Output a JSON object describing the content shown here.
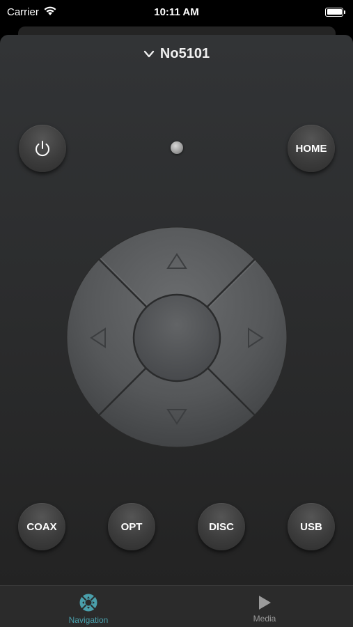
{
  "status_bar": {
    "carrier": "Carrier",
    "time": "10:11 AM",
    "icons": [
      "wifi-icon",
      "battery-icon"
    ]
  },
  "header": {
    "device_name": "No5101",
    "dropdown_icon": "chevron-down-icon"
  },
  "controls": {
    "power_icon": "power-icon",
    "home_label": "HOME",
    "indicator": "led-indicator"
  },
  "dpad": {
    "up_icon": "triangle-up-icon",
    "down_icon": "triangle-down-icon",
    "left_icon": "triangle-left-icon",
    "right_icon": "triangle-right-icon",
    "center": "ok-button"
  },
  "inputs": [
    {
      "label": "COAX"
    },
    {
      "label": "OPT"
    },
    {
      "label": "DISC"
    },
    {
      "label": "USB"
    }
  ],
  "tabs": [
    {
      "label": "Navigation",
      "icon": "navigation-icon",
      "active": true
    },
    {
      "label": "Media",
      "icon": "play-icon",
      "active": false
    }
  ],
  "colors": {
    "accent": "#4a9fab",
    "inactive_tab": "#9a9a9a",
    "background": "#2b2c2d"
  }
}
